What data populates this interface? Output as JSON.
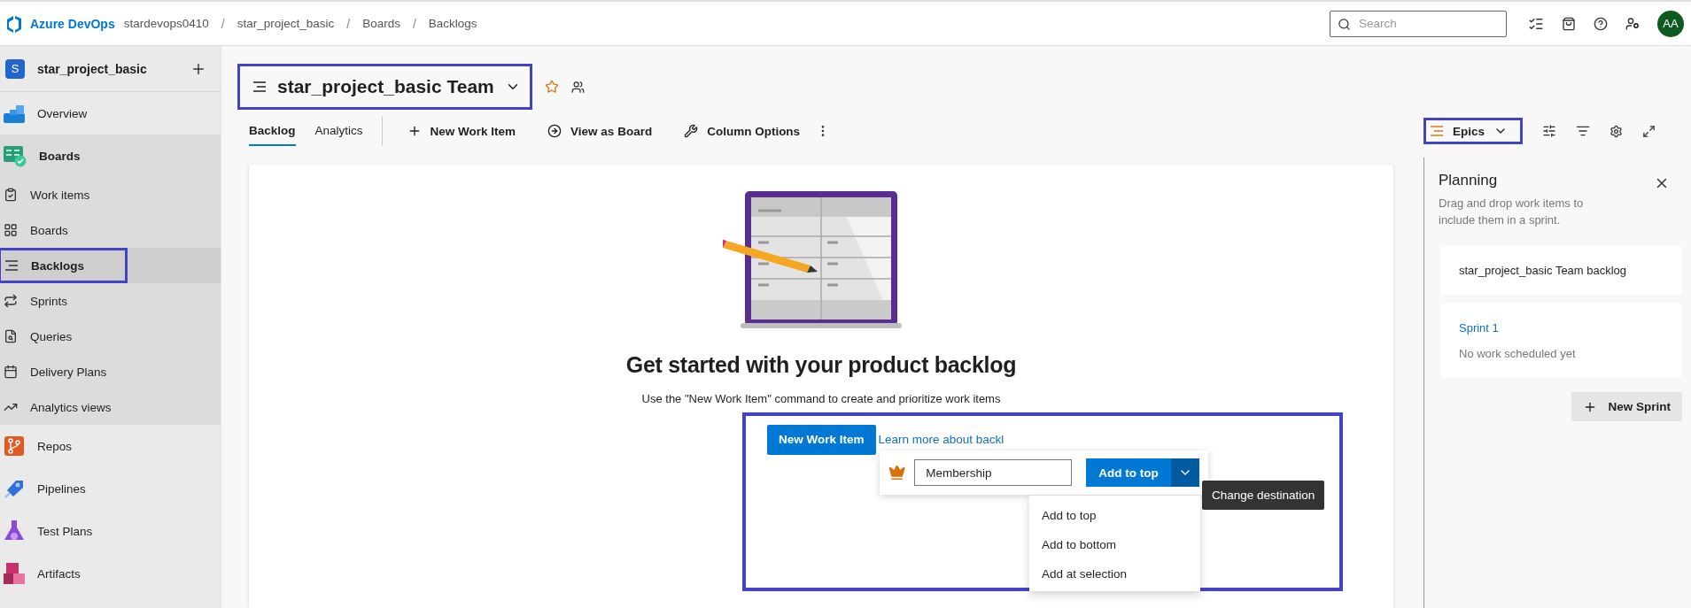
{
  "top_bar": {
    "product": "Azure DevOps",
    "breadcrumb_separator": "/",
    "breadcrumbs": [
      "stardevops0410",
      "star_project_basic",
      "Boards",
      "Backlogs"
    ],
    "search": {
      "placeholder": "Search"
    },
    "avatar": "AA"
  },
  "sidebar": {
    "project_initial": "S",
    "project": "star_project_basic",
    "items": [
      {
        "label": "Overview",
        "selected": false
      },
      {
        "label": "Boards",
        "selected": false,
        "children": [
          {
            "label": "Work items",
            "selected": false
          },
          {
            "label": "Boards",
            "selected": false
          },
          {
            "label": "Backlogs",
            "selected": true
          },
          {
            "label": "Sprints",
            "selected": false
          },
          {
            "label": "Queries",
            "selected": false
          },
          {
            "label": "Delivery Plans",
            "selected": false
          },
          {
            "label": "Analytics views",
            "selected": false
          }
        ]
      },
      {
        "label": "Repos",
        "selected": false
      },
      {
        "label": "Pipelines",
        "selected": false
      },
      {
        "label": "Test Plans",
        "selected": false
      },
      {
        "label": "Artifacts",
        "selected": false
      }
    ]
  },
  "header": {
    "team_title": "star_project_basic Team",
    "favorite": false,
    "tabs": [
      {
        "label": "Backlog",
        "selected": true
      },
      {
        "label": "Analytics",
        "selected": false
      }
    ],
    "commands": [
      "New Work Item",
      "View as Board",
      "Column Options"
    ],
    "backlog_level": "Epics"
  },
  "content": {
    "heading": "Get started with your product backlog",
    "description": "Use the \"New Work Item\" command to create and prioritize work items",
    "new_button": "New Work Item",
    "learn_more": "Learn more about backl",
    "quick_add": {
      "value": "Membership",
      "add_button": "Add to top"
    },
    "menu": [
      "Add to top",
      "Add to bottom",
      "Add at selection"
    ],
    "tooltip": "Change destination"
  },
  "planning": {
    "title": "Planning",
    "description": "Drag and drop work items to include them in a sprint.",
    "backlog_card": "star_project_basic Team backlog",
    "sprints": [
      {
        "name": "Sprint 1",
        "status": "No work scheduled yet"
      }
    ],
    "new_sprint": "New Sprint"
  }
}
